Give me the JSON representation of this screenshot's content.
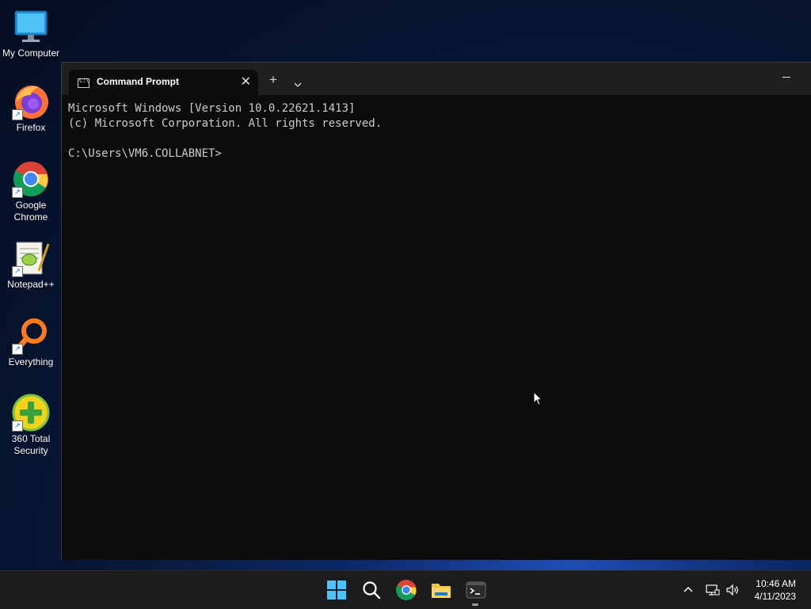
{
  "desktop": {
    "icons": [
      {
        "label": "My Computer",
        "icon": "monitor-icon"
      },
      {
        "label": "Firefox",
        "icon": "firefox-icon"
      },
      {
        "label": "Google Chrome",
        "icon": "chrome-icon"
      },
      {
        "label": "Notepad++",
        "icon": "notepadpp-icon"
      },
      {
        "label": "Everything",
        "icon": "everything-search-icon"
      },
      {
        "label": "360 Total Security",
        "icon": "security-360-icon"
      }
    ]
  },
  "terminal": {
    "tab_title": "Command Prompt",
    "lines": [
      "Microsoft Windows [Version 10.0.22621.1413]",
      "(c) Microsoft Corporation. All rights reserved.",
      "",
      "C:\\Users\\VM6.COLLABNET>"
    ]
  },
  "taskbar": {
    "apps": [
      "start-icon",
      "search-icon",
      "chrome-icon",
      "file-explorer-icon",
      "terminal-icon"
    ],
    "time": "10:46 AM",
    "date": "4/11/2023"
  },
  "colors": {
    "console_bg": "#0c0c0c",
    "console_text": "#cccccc",
    "titlebar": "#202020",
    "taskbar": "#1c1c1c"
  }
}
